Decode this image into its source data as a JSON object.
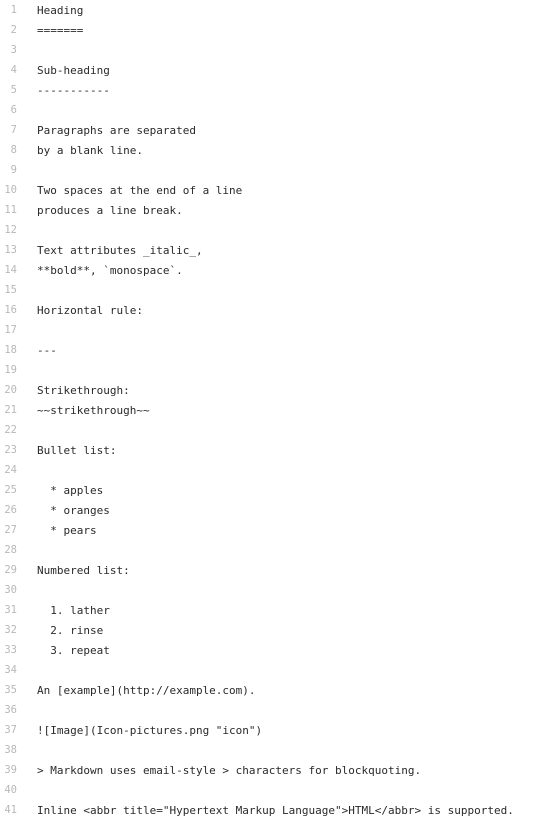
{
  "editor": {
    "lines": [
      {
        "num": "1",
        "text": "Heading"
      },
      {
        "num": "2",
        "text": "======="
      },
      {
        "num": "3",
        "text": ""
      },
      {
        "num": "4",
        "text": "Sub-heading"
      },
      {
        "num": "5",
        "text": "-----------"
      },
      {
        "num": "6",
        "text": ""
      },
      {
        "num": "7",
        "text": "Paragraphs are separated"
      },
      {
        "num": "8",
        "text": "by a blank line."
      },
      {
        "num": "9",
        "text": ""
      },
      {
        "num": "10",
        "text": "Two spaces at the end of a line"
      },
      {
        "num": "11",
        "text": "produces a line break."
      },
      {
        "num": "12",
        "text": ""
      },
      {
        "num": "13",
        "text": "Text attributes _italic_,"
      },
      {
        "num": "14",
        "text": "**bold**, `monospace`."
      },
      {
        "num": "15",
        "text": ""
      },
      {
        "num": "16",
        "text": "Horizontal rule:"
      },
      {
        "num": "17",
        "text": ""
      },
      {
        "num": "18",
        "text": "---"
      },
      {
        "num": "19",
        "text": ""
      },
      {
        "num": "20",
        "text": "Strikethrough:"
      },
      {
        "num": "21",
        "text": "~~strikethrough~~"
      },
      {
        "num": "22",
        "text": ""
      },
      {
        "num": "23",
        "text": "Bullet list:"
      },
      {
        "num": "24",
        "text": ""
      },
      {
        "num": "25",
        "text": "  * apples"
      },
      {
        "num": "26",
        "text": "  * oranges"
      },
      {
        "num": "27",
        "text": "  * pears"
      },
      {
        "num": "28",
        "text": ""
      },
      {
        "num": "29",
        "text": "Numbered list:"
      },
      {
        "num": "30",
        "text": ""
      },
      {
        "num": "31",
        "text": "  1. lather"
      },
      {
        "num": "32",
        "text": "  2. rinse"
      },
      {
        "num": "33",
        "text": "  3. repeat"
      },
      {
        "num": "34",
        "text": ""
      },
      {
        "num": "35",
        "text": "An [example](http://example.com)."
      },
      {
        "num": "36",
        "text": ""
      },
      {
        "num": "37",
        "text": "![Image](Icon-pictures.png \"icon\")"
      },
      {
        "num": "38",
        "text": ""
      },
      {
        "num": "39",
        "text": "> Markdown uses email-style > characters for blockquoting."
      },
      {
        "num": "40",
        "text": ""
      },
      {
        "num": "41",
        "text": "Inline <abbr title=\"Hypertext Markup Language\">HTML</abbr> is supported."
      }
    ]
  }
}
